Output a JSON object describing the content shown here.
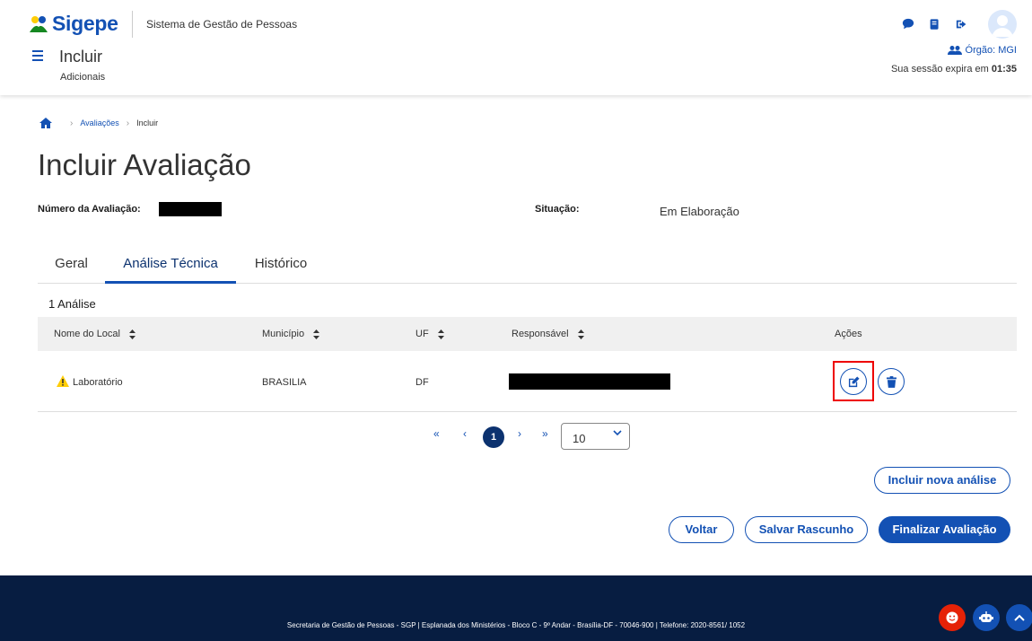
{
  "header": {
    "logo_text": "Sigepe",
    "system_name": "Sistema de Gestão de Pessoas",
    "page_title": "Incluir",
    "page_subtitle": "Adicionais",
    "orgao_label": "Órgão: MGI",
    "sessao_prefix": "Sua sessão expira em ",
    "sessao_time": "01:35",
    "icons": [
      "chat-icon",
      "book-icon",
      "logout-icon",
      "avatar"
    ]
  },
  "breadcrumb": {
    "items": [
      "Avaliações",
      "Incluir"
    ]
  },
  "main": {
    "title": "Incluir Avaliação",
    "numero_label": "Número da Avaliação:",
    "situacao_label": "Situação:",
    "situacao_value": "Em Elaboração"
  },
  "tabs": [
    {
      "label": "Geral",
      "active": false
    },
    {
      "label": "Análise Técnica",
      "active": true
    },
    {
      "label": "Histórico",
      "active": false
    }
  ],
  "table": {
    "count_label": "1 Análise",
    "columns": [
      "Nome do Local",
      "Município",
      "UF",
      "Responsável",
      "Ações"
    ],
    "rows": [
      {
        "nome_local": "Laboratório",
        "municipio": "BRASILIA",
        "uf": "DF",
        "responsavel": ""
      }
    ]
  },
  "pagination": {
    "first": "«",
    "prev": "‹",
    "current": "1",
    "next": "›",
    "last": "»",
    "page_size": "10"
  },
  "buttons": {
    "incluir_nova": "Incluir nova análise",
    "voltar": "Voltar",
    "salvar_rascunho": "Salvar Rascunho",
    "finalizar": "Finalizar Avaliação"
  },
  "footer": {
    "text": "Secretaria de Gestão de Pessoas - SGP | Esplanada dos Ministérios - Bloco C - 9º Andar - Brasília-DF - 70046-900 | Telefone: 2020-8561/ 1052"
  },
  "colors": {
    "primary": "#1351b4",
    "dark_blue": "#0c326f",
    "footer_bg": "#071d41",
    "warning": "#ffcd07",
    "highlight": "#e00000"
  }
}
